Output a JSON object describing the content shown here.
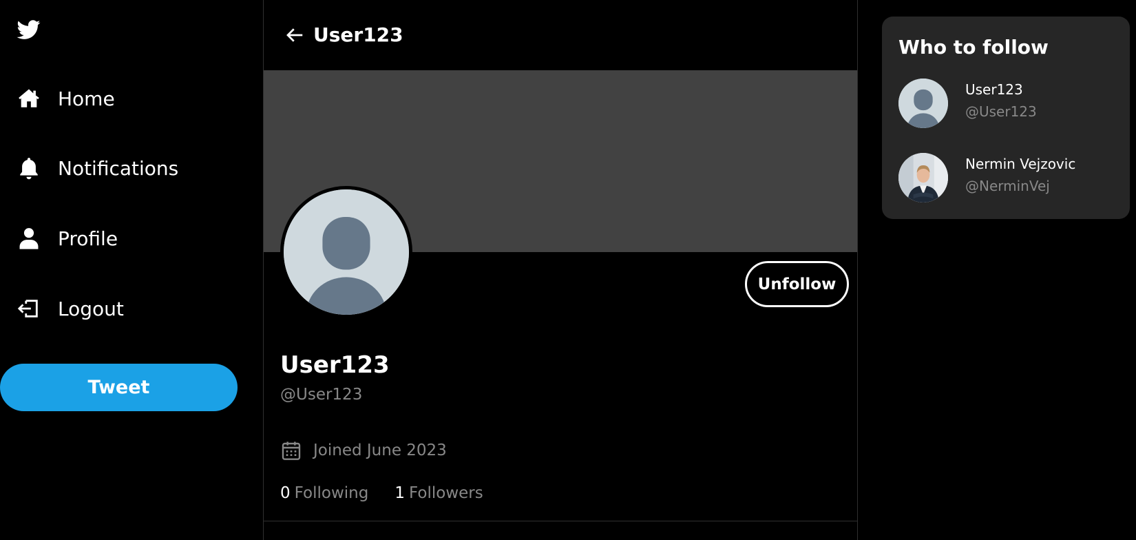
{
  "sidebar": {
    "items": [
      {
        "label": "Home",
        "icon": "home-icon"
      },
      {
        "label": "Notifications",
        "icon": "bell-icon"
      },
      {
        "label": "Profile",
        "icon": "user-icon"
      },
      {
        "label": "Logout",
        "icon": "logout-icon"
      }
    ],
    "tweet_label": "Tweet"
  },
  "header": {
    "title": "User123"
  },
  "profile": {
    "name": "User123",
    "handle": "@User123",
    "joined": "Joined June 2023",
    "following_count": "0",
    "following_label": "Following",
    "followers_count": "1",
    "followers_label": "Followers",
    "unfollow_label": "Unfollow"
  },
  "who_to_follow": {
    "title": "Who to follow",
    "users": [
      {
        "name": "User123",
        "handle": "@User123",
        "avatar": "default-avatar"
      },
      {
        "name": "Nermin Vejzovic",
        "handle": "@NerminVej",
        "avatar": "photo-avatar"
      }
    ]
  },
  "colors": {
    "background": "#000000",
    "accent": "#1ba1e6",
    "banner": "#424242",
    "panel": "#262626",
    "muted_text": "#888888"
  }
}
